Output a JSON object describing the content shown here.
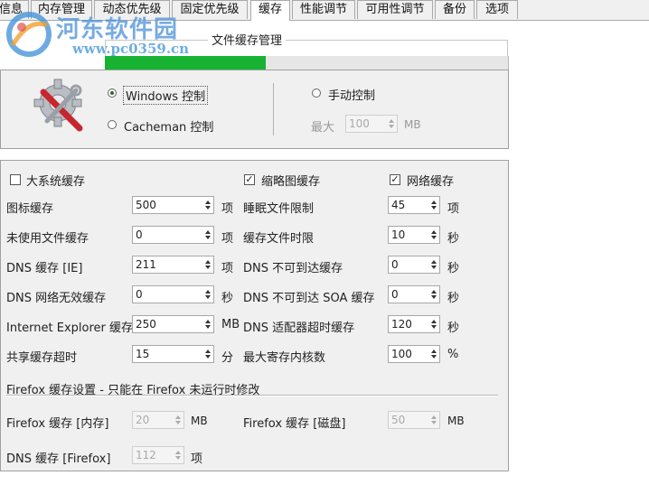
{
  "tabs": [
    "信息",
    "内存管理",
    "动态优先级",
    "固定优先级",
    "缓存",
    "性能调节",
    "可用性调节",
    "备份",
    "选项"
  ],
  "active_tab": 4,
  "watermark": {
    "text": "河东软件园",
    "url": "www.pc0359.cn"
  },
  "group_title": "文件缓存管理",
  "progress_fraction": 0.4,
  "mode": {
    "windows_label": "Windows 控制",
    "cacheman_label": "Cacheman 控制",
    "manual_label": "手动控制",
    "max_label": "最大",
    "max_value": "100",
    "max_unit": "MB"
  },
  "checks": {
    "big_cache": {
      "label": "大系统缓存",
      "checked": false
    },
    "thumb_cache": {
      "label": "缩略图缓存",
      "checked": true
    },
    "net_cache": {
      "label": "网络缓存",
      "checked": true
    }
  },
  "left_rows": [
    {
      "label": "图标缓存",
      "value": "500",
      "unit": "项"
    },
    {
      "label": "未使用文件缓存",
      "value": "0",
      "unit": "项"
    },
    {
      "label": "DNS 缓存 [IE]",
      "value": "211",
      "unit": "项"
    },
    {
      "label": "DNS 网络无效缓存",
      "value": "0",
      "unit": "秒"
    },
    {
      "label": "Internet Explorer 缓存",
      "value": "250",
      "unit": "MB"
    },
    {
      "label": "共享缓存超时",
      "value": "15",
      "unit": "分"
    }
  ],
  "right_rows": [
    {
      "label": "睡眠文件限制",
      "value": "45",
      "unit": "项"
    },
    {
      "label": "缓存文件时限",
      "value": "10",
      "unit": "秒"
    },
    {
      "label": "DNS 不可到达缓存",
      "value": "0",
      "unit": "秒"
    },
    {
      "label": "DNS 不可到达 SOA 缓存",
      "value": "0",
      "unit": "秒"
    },
    {
      "label": "DNS 适配器超时缓存",
      "value": "120",
      "unit": "秒"
    },
    {
      "label": "最大寄存内核数",
      "value": "100",
      "unit": "%"
    }
  ],
  "firefox": {
    "section_title": "Firefox 缓存设置 - 只能在 Firefox 未运行时修改",
    "mem_label": "Firefox 缓存 [内存]",
    "mem_value": "20",
    "mem_unit": "MB",
    "disk_label": "Firefox 缓存 [磁盘]",
    "disk_value": "50",
    "disk_unit": "MB",
    "dns_label": "DNS 缓存 [Firefox]",
    "dns_value": "112",
    "dns_unit": "项"
  }
}
